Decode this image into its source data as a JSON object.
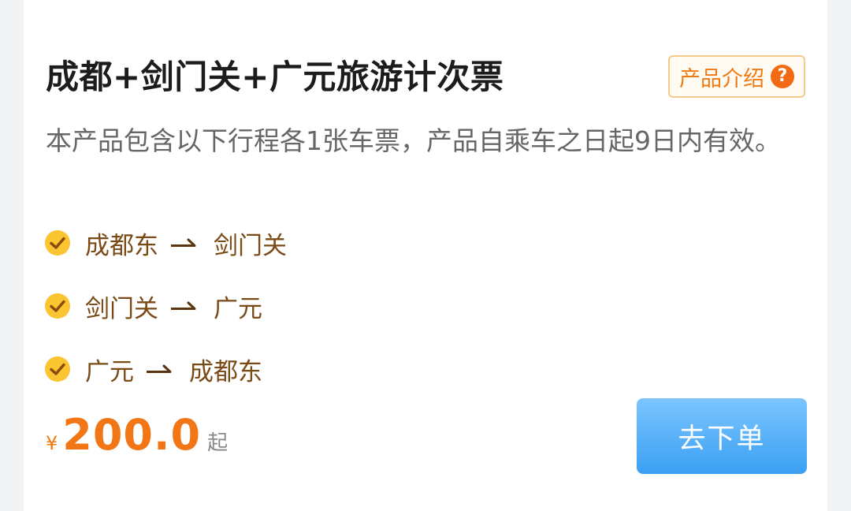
{
  "product": {
    "title": "成都+剑门关+广元旅游计次票",
    "intro_label": "产品介绍",
    "help_icon": "question-circle-icon",
    "description": "本产品包含以下行程各1张车票，产品自乘车之日起9日内有效。"
  },
  "routes": [
    {
      "from": "成都东",
      "to": "剑门关"
    },
    {
      "from": "剑门关",
      "to": "广元"
    },
    {
      "from": "广元",
      "to": "成都东"
    }
  ],
  "icons": {
    "check": "check-circle-icon",
    "arrow": "right-arrow-icon"
  },
  "price": {
    "currency": "¥",
    "amount": "200.0",
    "suffix": "起"
  },
  "actions": {
    "order_label": "去下单"
  },
  "colors": {
    "accent_orange": "#f37616",
    "route_text": "#7a4a16",
    "check_yellow": "#fbc531",
    "button_blue": "#3a9ff2"
  }
}
